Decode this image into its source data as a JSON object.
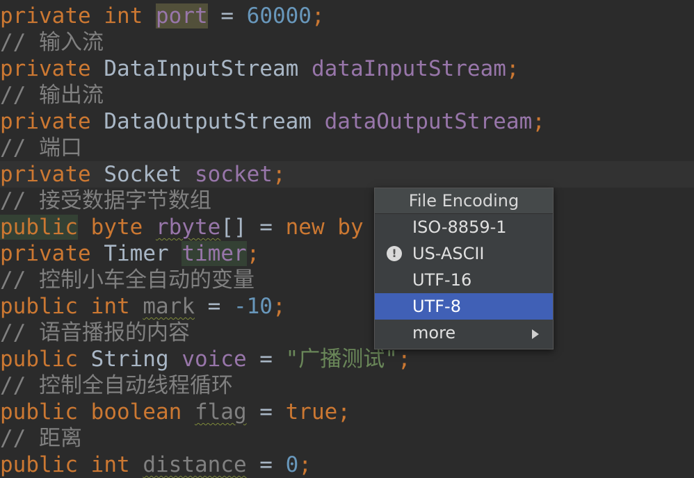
{
  "code": {
    "l1": {
      "kw": "private",
      "kw2": "int",
      "field": "port",
      "eq": " = ",
      "num": "60000",
      "semi": ";"
    },
    "l2": {
      "comment": "// 输入流"
    },
    "l3": {
      "kw": "private",
      "type": "DataInputStream",
      "field": "dataInputStream",
      "semi": ";"
    },
    "l4": {
      "comment": "// 输出流"
    },
    "l5": {
      "kw": "private",
      "type": "DataOutputStream",
      "field": "dataOutputStream",
      "semi": ";"
    },
    "l6": {
      "comment": "// 端口"
    },
    "l7": {
      "kw": "private",
      "type": "Socket",
      "field": "socket",
      "semi": ";"
    },
    "l8": {
      "comment": "// 接受数据字节数组"
    },
    "l9": {
      "kw": "public",
      "kw2": "byte",
      "field": "rbyte",
      "brackets": "[]",
      "eq": " = ",
      "kw3": "new",
      "rest": "by"
    },
    "l10": {
      "kw": "private",
      "type": "Timer",
      "field": "timer",
      "semi": ";"
    },
    "l11": {
      "comment": "// 控制小车全自动的变量"
    },
    "l12": {
      "kw": "public",
      "kw2": "int",
      "field": "mark",
      "eq": " = ",
      "num": "-10",
      "semi": ";"
    },
    "l13": {
      "comment": "// 语音播报的内容"
    },
    "l14": {
      "kw": "public",
      "type": "String",
      "field": "voice",
      "eq": " = ",
      "str": "\"广播测试\"",
      "semi": ";"
    },
    "l15": {
      "comment": "// 控制全自动线程循环"
    },
    "l16": {
      "kw": "public",
      "kw2": "boolean",
      "field": "flag",
      "eq": " = ",
      "kw3": "true",
      "semi": ";"
    },
    "l17": {
      "comment": "// 距离"
    },
    "l18": {
      "kw": "public",
      "kw2": "int",
      "field": "distance",
      "eq": " = ",
      "num": "0",
      "semi": ";"
    }
  },
  "encoding_popup": {
    "title": "File Encoding",
    "items": [
      {
        "label": "ISO-8859-1"
      },
      {
        "label": "US-ASCII",
        "icon": "warning-icon"
      },
      {
        "label": "UTF-16"
      },
      {
        "label": "UTF-8",
        "selected": true
      },
      {
        "label": "more",
        "icon": "submenu-arrow-icon"
      }
    ]
  },
  "colors": {
    "background": "#2b2b2b",
    "keyword": "#cc7832",
    "number": "#6897bb",
    "field": "#9876aa",
    "comment": "#808080",
    "string": "#6a8759",
    "selection": "#4060b6"
  }
}
